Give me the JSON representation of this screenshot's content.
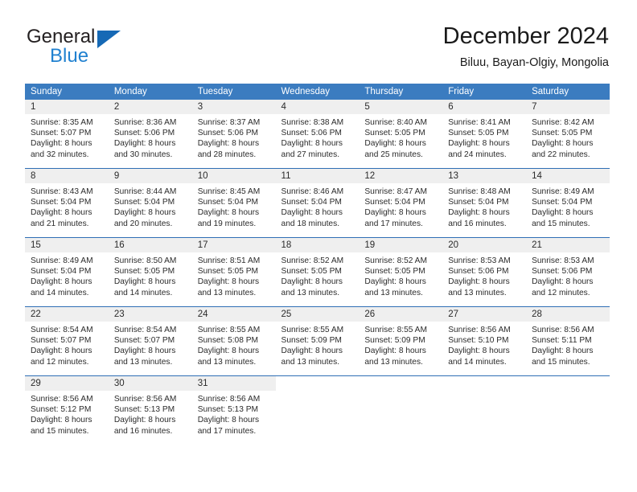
{
  "brand": {
    "name_top": "General",
    "name_bottom": "Blue",
    "flag_color": "#1669b5",
    "blue_text_color": "#2081d0"
  },
  "header": {
    "title": "December 2024",
    "subtitle": "Biluu, Bayan-Olgiy, Mongolia"
  },
  "theme": {
    "header_bg": "#3b7cc0",
    "row_divider": "#2f6fb5",
    "day_number_bg": "#efefef"
  },
  "calendar": {
    "weekday_headers": [
      "Sunday",
      "Monday",
      "Tuesday",
      "Wednesday",
      "Thursday",
      "Friday",
      "Saturday"
    ],
    "weeks": [
      [
        {
          "day": "1",
          "sunrise": "Sunrise: 8:35 AM",
          "sunset": "Sunset: 5:07 PM",
          "daylight1": "Daylight: 8 hours",
          "daylight2": "and 32 minutes."
        },
        {
          "day": "2",
          "sunrise": "Sunrise: 8:36 AM",
          "sunset": "Sunset: 5:06 PM",
          "daylight1": "Daylight: 8 hours",
          "daylight2": "and 30 minutes."
        },
        {
          "day": "3",
          "sunrise": "Sunrise: 8:37 AM",
          "sunset": "Sunset: 5:06 PM",
          "daylight1": "Daylight: 8 hours",
          "daylight2": "and 28 minutes."
        },
        {
          "day": "4",
          "sunrise": "Sunrise: 8:38 AM",
          "sunset": "Sunset: 5:06 PM",
          "daylight1": "Daylight: 8 hours",
          "daylight2": "and 27 minutes."
        },
        {
          "day": "5",
          "sunrise": "Sunrise: 8:40 AM",
          "sunset": "Sunset: 5:05 PM",
          "daylight1": "Daylight: 8 hours",
          "daylight2": "and 25 minutes."
        },
        {
          "day": "6",
          "sunrise": "Sunrise: 8:41 AM",
          "sunset": "Sunset: 5:05 PM",
          "daylight1": "Daylight: 8 hours",
          "daylight2": "and 24 minutes."
        },
        {
          "day": "7",
          "sunrise": "Sunrise: 8:42 AM",
          "sunset": "Sunset: 5:05 PM",
          "daylight1": "Daylight: 8 hours",
          "daylight2": "and 22 minutes."
        }
      ],
      [
        {
          "day": "8",
          "sunrise": "Sunrise: 8:43 AM",
          "sunset": "Sunset: 5:04 PM",
          "daylight1": "Daylight: 8 hours",
          "daylight2": "and 21 minutes."
        },
        {
          "day": "9",
          "sunrise": "Sunrise: 8:44 AM",
          "sunset": "Sunset: 5:04 PM",
          "daylight1": "Daylight: 8 hours",
          "daylight2": "and 20 minutes."
        },
        {
          "day": "10",
          "sunrise": "Sunrise: 8:45 AM",
          "sunset": "Sunset: 5:04 PM",
          "daylight1": "Daylight: 8 hours",
          "daylight2": "and 19 minutes."
        },
        {
          "day": "11",
          "sunrise": "Sunrise: 8:46 AM",
          "sunset": "Sunset: 5:04 PM",
          "daylight1": "Daylight: 8 hours",
          "daylight2": "and 18 minutes."
        },
        {
          "day": "12",
          "sunrise": "Sunrise: 8:47 AM",
          "sunset": "Sunset: 5:04 PM",
          "daylight1": "Daylight: 8 hours",
          "daylight2": "and 17 minutes."
        },
        {
          "day": "13",
          "sunrise": "Sunrise: 8:48 AM",
          "sunset": "Sunset: 5:04 PM",
          "daylight1": "Daylight: 8 hours",
          "daylight2": "and 16 minutes."
        },
        {
          "day": "14",
          "sunrise": "Sunrise: 8:49 AM",
          "sunset": "Sunset: 5:04 PM",
          "daylight1": "Daylight: 8 hours",
          "daylight2": "and 15 minutes."
        }
      ],
      [
        {
          "day": "15",
          "sunrise": "Sunrise: 8:49 AM",
          "sunset": "Sunset: 5:04 PM",
          "daylight1": "Daylight: 8 hours",
          "daylight2": "and 14 minutes."
        },
        {
          "day": "16",
          "sunrise": "Sunrise: 8:50 AM",
          "sunset": "Sunset: 5:05 PM",
          "daylight1": "Daylight: 8 hours",
          "daylight2": "and 14 minutes."
        },
        {
          "day": "17",
          "sunrise": "Sunrise: 8:51 AM",
          "sunset": "Sunset: 5:05 PM",
          "daylight1": "Daylight: 8 hours",
          "daylight2": "and 13 minutes."
        },
        {
          "day": "18",
          "sunrise": "Sunrise: 8:52 AM",
          "sunset": "Sunset: 5:05 PM",
          "daylight1": "Daylight: 8 hours",
          "daylight2": "and 13 minutes."
        },
        {
          "day": "19",
          "sunrise": "Sunrise: 8:52 AM",
          "sunset": "Sunset: 5:05 PM",
          "daylight1": "Daylight: 8 hours",
          "daylight2": "and 13 minutes."
        },
        {
          "day": "20",
          "sunrise": "Sunrise: 8:53 AM",
          "sunset": "Sunset: 5:06 PM",
          "daylight1": "Daylight: 8 hours",
          "daylight2": "and 13 minutes."
        },
        {
          "day": "21",
          "sunrise": "Sunrise: 8:53 AM",
          "sunset": "Sunset: 5:06 PM",
          "daylight1": "Daylight: 8 hours",
          "daylight2": "and 12 minutes."
        }
      ],
      [
        {
          "day": "22",
          "sunrise": "Sunrise: 8:54 AM",
          "sunset": "Sunset: 5:07 PM",
          "daylight1": "Daylight: 8 hours",
          "daylight2": "and 12 minutes."
        },
        {
          "day": "23",
          "sunrise": "Sunrise: 8:54 AM",
          "sunset": "Sunset: 5:07 PM",
          "daylight1": "Daylight: 8 hours",
          "daylight2": "and 13 minutes."
        },
        {
          "day": "24",
          "sunrise": "Sunrise: 8:55 AM",
          "sunset": "Sunset: 5:08 PM",
          "daylight1": "Daylight: 8 hours",
          "daylight2": "and 13 minutes."
        },
        {
          "day": "25",
          "sunrise": "Sunrise: 8:55 AM",
          "sunset": "Sunset: 5:09 PM",
          "daylight1": "Daylight: 8 hours",
          "daylight2": "and 13 minutes."
        },
        {
          "day": "26",
          "sunrise": "Sunrise: 8:55 AM",
          "sunset": "Sunset: 5:09 PM",
          "daylight1": "Daylight: 8 hours",
          "daylight2": "and 13 minutes."
        },
        {
          "day": "27",
          "sunrise": "Sunrise: 8:56 AM",
          "sunset": "Sunset: 5:10 PM",
          "daylight1": "Daylight: 8 hours",
          "daylight2": "and 14 minutes."
        },
        {
          "day": "28",
          "sunrise": "Sunrise: 8:56 AM",
          "sunset": "Sunset: 5:11 PM",
          "daylight1": "Daylight: 8 hours",
          "daylight2": "and 15 minutes."
        }
      ],
      [
        {
          "day": "29",
          "sunrise": "Sunrise: 8:56 AM",
          "sunset": "Sunset: 5:12 PM",
          "daylight1": "Daylight: 8 hours",
          "daylight2": "and 15 minutes."
        },
        {
          "day": "30",
          "sunrise": "Sunrise: 8:56 AM",
          "sunset": "Sunset: 5:13 PM",
          "daylight1": "Daylight: 8 hours",
          "daylight2": "and 16 minutes."
        },
        {
          "day": "31",
          "sunrise": "Sunrise: 8:56 AM",
          "sunset": "Sunset: 5:13 PM",
          "daylight1": "Daylight: 8 hours",
          "daylight2": "and 17 minutes."
        },
        {
          "day": "",
          "sunrise": "",
          "sunset": "",
          "daylight1": "",
          "daylight2": ""
        },
        {
          "day": "",
          "sunrise": "",
          "sunset": "",
          "daylight1": "",
          "daylight2": ""
        },
        {
          "day": "",
          "sunrise": "",
          "sunset": "",
          "daylight1": "",
          "daylight2": ""
        },
        {
          "day": "",
          "sunrise": "",
          "sunset": "",
          "daylight1": "",
          "daylight2": ""
        }
      ]
    ]
  }
}
